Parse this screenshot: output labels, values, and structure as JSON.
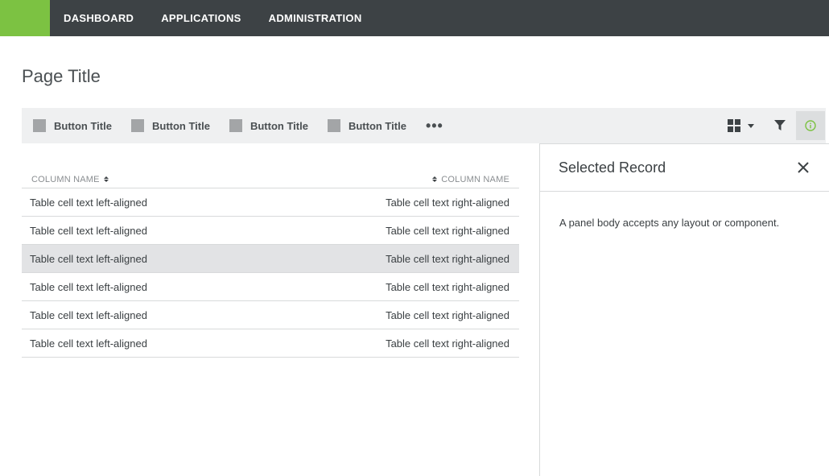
{
  "nav": {
    "items": [
      {
        "label": "DASHBOARD"
      },
      {
        "label": "APPLICATIONS"
      },
      {
        "label": "ADMINISTRATION"
      }
    ]
  },
  "page": {
    "title": "Page Title"
  },
  "toolbar": {
    "buttons": [
      {
        "label": "Button Title"
      },
      {
        "label": "Button Title"
      },
      {
        "label": "Button Title"
      },
      {
        "label": "Button Title"
      }
    ],
    "more_label": "•••"
  },
  "table": {
    "columns": [
      {
        "label": "COLUMN NAME"
      },
      {
        "label": "COLUMN NAME"
      }
    ],
    "rows": [
      {
        "left": "Table cell text left-aligned",
        "right": "Table cell text right-aligned"
      },
      {
        "left": "Table cell text left-aligned",
        "right": "Table cell text right-aligned"
      },
      {
        "left": "Table cell text left-aligned",
        "right": "Table cell text right-aligned"
      },
      {
        "left": "Table cell text left-aligned",
        "right": "Table cell text right-aligned"
      },
      {
        "left": "Table cell text left-aligned",
        "right": "Table cell text right-aligned"
      },
      {
        "left": "Table cell text left-aligned",
        "right": "Table cell text right-aligned"
      }
    ],
    "selected_row": 2
  },
  "panel": {
    "title": "Selected Record",
    "body": "A panel body accepts any layout or component."
  },
  "colors": {
    "brand": "#7cc242",
    "nav_bg": "#3d4245",
    "info_icon": "#7cc242"
  },
  "icons": {
    "grid": "grid-view-icon",
    "filter": "filter-icon",
    "info": "info-icon",
    "close": "close-icon"
  }
}
